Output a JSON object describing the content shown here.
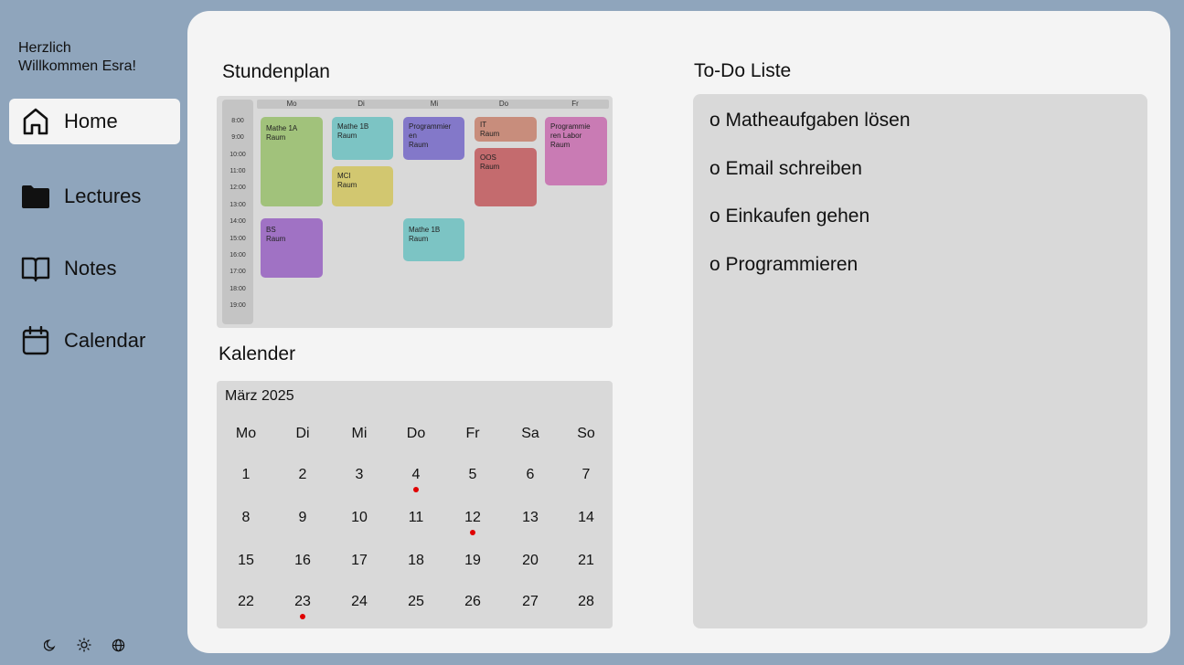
{
  "sidebar": {
    "welcome_line1": "Herzlich",
    "welcome_line2": "Willkommen Esra!",
    "items": [
      {
        "label": "Home",
        "icon": "home-icon",
        "active": true
      },
      {
        "label": "Lectures",
        "icon": "folder-icon",
        "active": false
      },
      {
        "label": "Notes",
        "icon": "book-icon",
        "active": false
      },
      {
        "label": "Calendar",
        "icon": "calendar-icon",
        "active": false
      }
    ],
    "bottom_icons": [
      "moon-icon",
      "sun-icon",
      "globe-icon"
    ]
  },
  "schedule": {
    "title": "Stundenplan",
    "days": [
      "Mo",
      "Di",
      "Mi",
      "Do",
      "Fr"
    ],
    "times": [
      "8:00",
      "9:00",
      "10:00",
      "11:00",
      "12:00",
      "13:00",
      "14:00",
      "15:00",
      "16:00",
      "17:00",
      "18:00",
      "19:00"
    ],
    "events": [
      {
        "line1": "Mathe 1A",
        "line2": "Raum",
        "line3": "",
        "color": "#a1c27b"
      },
      {
        "line1": "Mathe 1B",
        "line2": "Raum",
        "line3": "",
        "color": "#7cc4c4"
      },
      {
        "line1": "MCI",
        "line2": "Raum",
        "line3": "",
        "color": "#d2c770"
      },
      {
        "line1": "Programmier",
        "line2": "en",
        "line3": "Raum",
        "color": "#8378c9"
      },
      {
        "line1": "IT",
        "line2": "Raum",
        "line3": "",
        "color": "#c88d7c"
      },
      {
        "line1": "OOS",
        "line2": "Raum",
        "line3": "",
        "color": "#c46b6e"
      },
      {
        "line1": "Programmie",
        "line2": "ren Labor",
        "line3": "Raum",
        "color": "#c97bb4"
      },
      {
        "line1": "BS",
        "line2": "Raum",
        "line3": "",
        "color": "#a072c4"
      },
      {
        "line1": "Mathe 1B",
        "line2": "Raum",
        "line3": "",
        "color": "#7cc4c4"
      }
    ]
  },
  "calendar": {
    "title": "Kalender",
    "month": "März 2025",
    "weekdays": [
      "Mo",
      "Di",
      "Mi",
      "Do",
      "Fr",
      "Sa",
      "So"
    ],
    "weeks": [
      [
        "1",
        "2",
        "3",
        "4",
        "5",
        "6",
        "7"
      ],
      [
        "8",
        "9",
        "10",
        "11",
        "12",
        "13",
        "14"
      ],
      [
        "15",
        "16",
        "17",
        "18",
        "19",
        "20",
        "21"
      ],
      [
        "22",
        "23",
        "24",
        "25",
        "26",
        "27",
        "28"
      ]
    ],
    "marked_days": [
      "4",
      "12",
      "23"
    ],
    "marker_color": "#e00000"
  },
  "todo": {
    "title": "To-Do Liste",
    "items": [
      "o Matheaufgaben lösen",
      "o Email schreiben",
      "o Einkaufen gehen",
      "o Programmieren"
    ]
  }
}
